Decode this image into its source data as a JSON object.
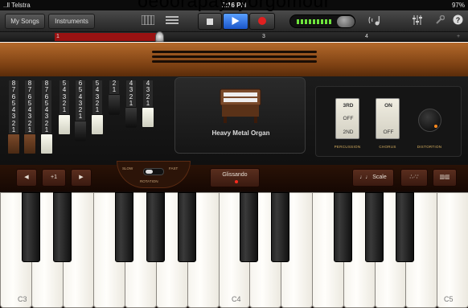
{
  "status_bar": {
    "carrier": "..ll Telstra",
    "time": "2:16 PM",
    "battery": "97%"
  },
  "caption": "oeoorapay..yorgomour",
  "toolbar": {
    "my_songs": "My Songs",
    "instruments": "Instruments"
  },
  "ruler": {
    "marks": [
      "1",
      "3",
      "4"
    ]
  },
  "drawbars": [
    {
      "numbers": [
        "8",
        "7",
        "6",
        "5",
        "4",
        "3",
        "2",
        "1"
      ],
      "color": "brown",
      "position": 8
    },
    {
      "numbers": [
        "8",
        "7",
        "6",
        "5",
        "4",
        "3",
        "2",
        "1"
      ],
      "color": "brown",
      "position": 8
    },
    {
      "numbers": [
        "8",
        "7",
        "6",
        "5",
        "4",
        "3",
        "2",
        "1"
      ],
      "color": "white",
      "position": 8
    },
    {
      "numbers": [
        "5",
        "4",
        "3",
        "2",
        "1"
      ],
      "color": "white",
      "position": 5
    },
    {
      "numbers": [
        "6",
        "5",
        "4",
        "3",
        "2",
        "1"
      ],
      "color": "black",
      "position": 6
    },
    {
      "numbers": [
        "5",
        "4",
        "3",
        "2",
        "1"
      ],
      "color": "white",
      "position": 5
    },
    {
      "numbers": [
        "2",
        "1"
      ],
      "color": "black",
      "position": 2
    },
    {
      "numbers": [
        "4",
        "3",
        "2",
        "1"
      ],
      "color": "black",
      "position": 4
    },
    {
      "numbers": [
        "4",
        "3",
        "2",
        "1"
      ],
      "color": "white",
      "position": 4
    }
  ],
  "organ": {
    "name": "Heavy Metal Organ"
  },
  "effects": {
    "percussion": {
      "top": "3RD",
      "middle": "OFF",
      "bottom": "2ND",
      "label": "PERCUSSION"
    },
    "chorus": {
      "top": "ON",
      "bottom": "OFF",
      "label": "CHORUS"
    },
    "distortion": {
      "label": "DISTORTION"
    }
  },
  "controls": {
    "octave_down": "◀",
    "octave_value": "+1",
    "octave_up": "▶",
    "rotation": {
      "slow": "SLOW",
      "fast": "FAST",
      "label": "ROTATION"
    },
    "glissando": "Glissando",
    "scale": "♩♩ Scale",
    "arpeggio": "∴·∵",
    "keyboard_layout": "▥▥"
  },
  "keyboard": {
    "labels": [
      "C3",
      "C4",
      "C5"
    ]
  }
}
